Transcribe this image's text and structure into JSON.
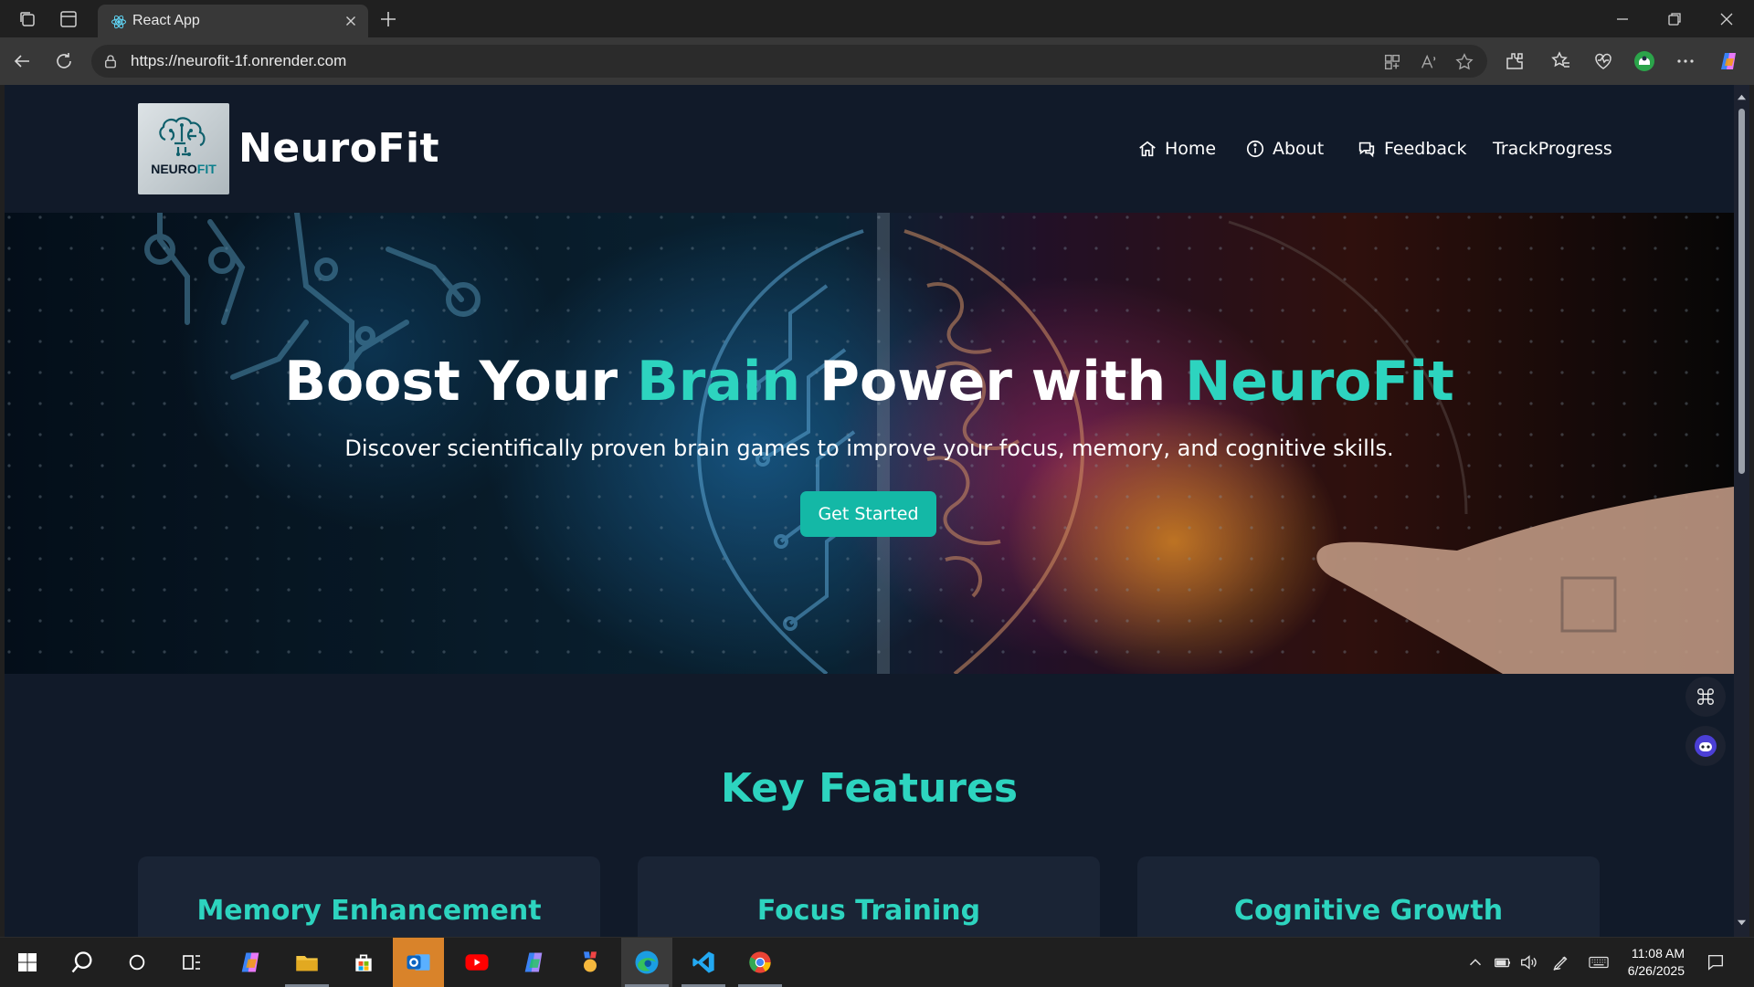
{
  "browser": {
    "tab_title": "React App",
    "url": "https://neurofit-1f.onrender.com"
  },
  "site": {
    "brand": "NeuroFit",
    "logo_text_main": "NEURO",
    "logo_text_accent": "FIT",
    "nav": [
      {
        "label": "Home",
        "icon": "home-icon"
      },
      {
        "label": "About",
        "icon": "info-icon"
      },
      {
        "label": "Feedback",
        "icon": "chat-icon"
      },
      {
        "label": "TrackProgress",
        "icon": ""
      }
    ]
  },
  "hero": {
    "title_part1": "Boost Your ",
    "title_accent1": "Brain",
    "title_part2": " Power with ",
    "title_accent2": "NeuroFit",
    "subtitle": "Discover scientifically proven brain games to improve your focus, memory, and cognitive skills.",
    "cta_label": "Get Started"
  },
  "features": {
    "heading": "Key Features",
    "cards": [
      {
        "title": "Memory Enhancement"
      },
      {
        "title": "Focus Training"
      },
      {
        "title": "Cognitive Growth"
      }
    ]
  },
  "taskbar": {
    "time": "11:08 AM",
    "date": "6/26/2025"
  },
  "colors": {
    "accent": "#2dd4bf",
    "button": "#14b8a6",
    "page_bg": "#111a29",
    "card_bg": "#1a2435"
  }
}
